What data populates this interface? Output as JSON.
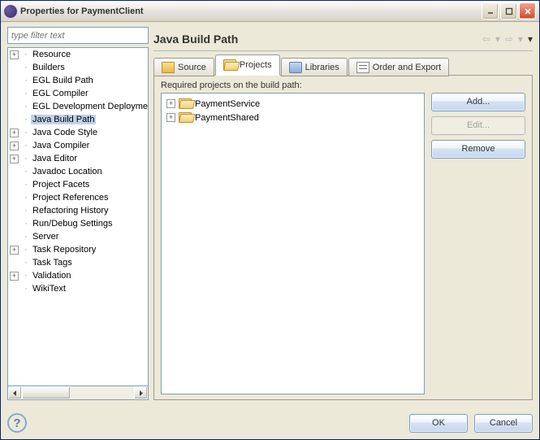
{
  "window": {
    "title": "Properties for PaymentClient"
  },
  "filter": {
    "placeholder": "type filter text"
  },
  "tree": [
    {
      "label": "Resource",
      "expandable": true,
      "selected": false
    },
    {
      "label": "Builders",
      "expandable": false,
      "selected": false
    },
    {
      "label": "EGL Build Path",
      "expandable": false,
      "selected": false
    },
    {
      "label": "EGL Compiler",
      "expandable": false,
      "selected": false
    },
    {
      "label": "EGL Development Deployment",
      "expandable": false,
      "selected": false
    },
    {
      "label": "Java Build Path",
      "expandable": false,
      "selected": true
    },
    {
      "label": "Java Code Style",
      "expandable": true,
      "selected": false
    },
    {
      "label": "Java Compiler",
      "expandable": true,
      "selected": false
    },
    {
      "label": "Java Editor",
      "expandable": true,
      "selected": false
    },
    {
      "label": "Javadoc Location",
      "expandable": false,
      "selected": false
    },
    {
      "label": "Project Facets",
      "expandable": false,
      "selected": false
    },
    {
      "label": "Project References",
      "expandable": false,
      "selected": false
    },
    {
      "label": "Refactoring History",
      "expandable": false,
      "selected": false
    },
    {
      "label": "Run/Debug Settings",
      "expandable": false,
      "selected": false
    },
    {
      "label": "Server",
      "expandable": false,
      "selected": false
    },
    {
      "label": "Task Repository",
      "expandable": true,
      "selected": false
    },
    {
      "label": "Task Tags",
      "expandable": false,
      "selected": false
    },
    {
      "label": "Validation",
      "expandable": true,
      "selected": false
    },
    {
      "label": "WikiText",
      "expandable": false,
      "selected": false
    }
  ],
  "page": {
    "heading": "Java Build Path",
    "tabs": {
      "source": "Source",
      "projects": "Projects",
      "libraries": "Libraries",
      "order": "Order and Export"
    },
    "active_tab": "projects",
    "required_label": "Required projects on the build path:",
    "projects": [
      {
        "name": "PaymentService"
      },
      {
        "name": "PaymentShared"
      }
    ],
    "buttons": {
      "add": "Add...",
      "edit": "Edit...",
      "remove": "Remove"
    }
  },
  "footer": {
    "ok": "OK",
    "cancel": "Cancel"
  }
}
